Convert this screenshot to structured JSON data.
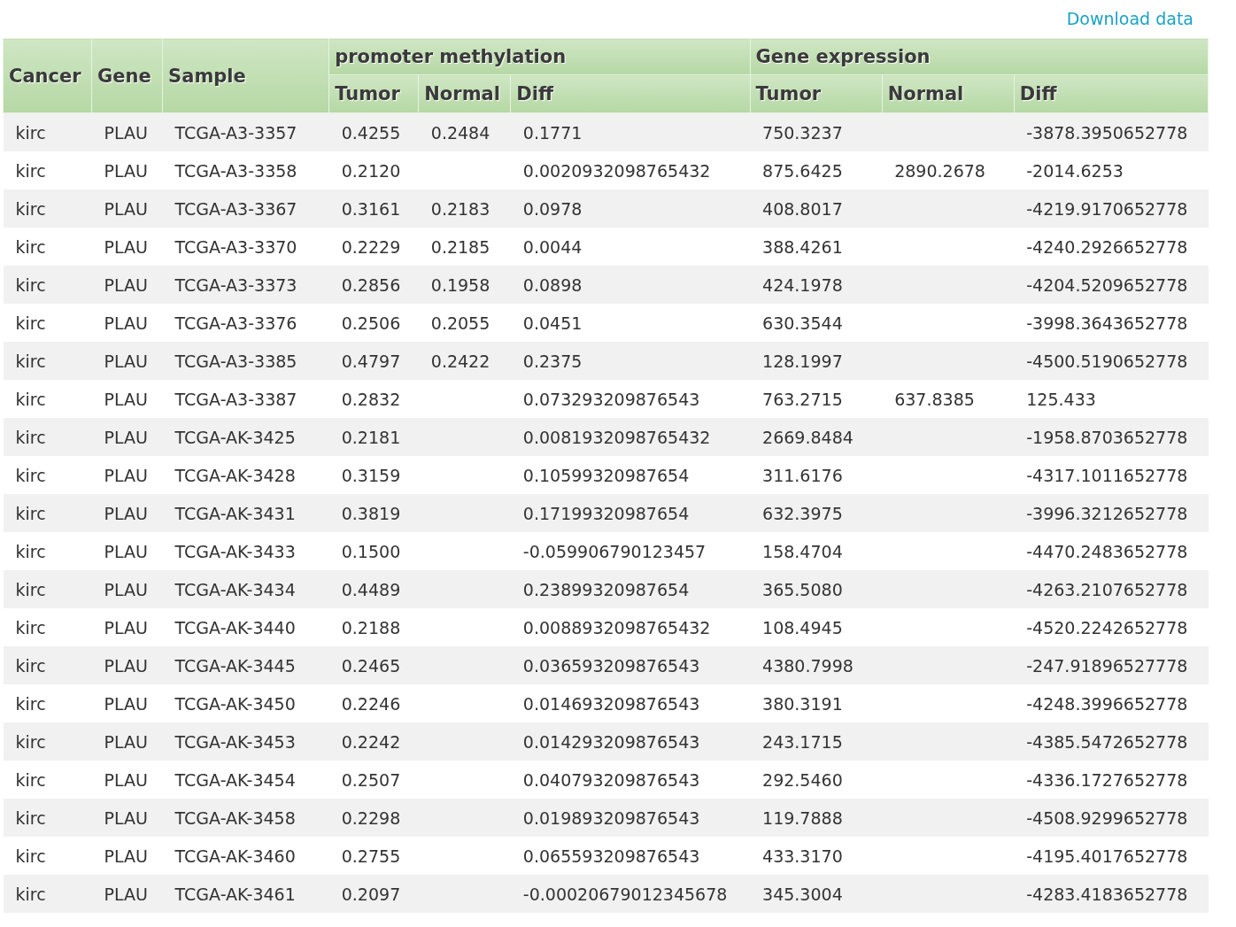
{
  "download_link": "Download data",
  "table": {
    "columns": [
      "Cancer",
      "Gene",
      "Sample"
    ],
    "groups": [
      {
        "title": "promoter methylation",
        "columns": [
          "Tumor",
          "Normal",
          "Diff"
        ]
      },
      {
        "title": "Gene expression",
        "columns": [
          "Tumor",
          "Normal",
          "Diff"
        ]
      }
    ],
    "rows": [
      {
        "cancer": "kirc",
        "gene": "PLAU",
        "sample": "TCGA-A3-3357",
        "meth_tumor": "0.4255",
        "meth_normal": "0.2484",
        "meth_diff": "0.1771",
        "expr_tumor": "750.3237",
        "expr_diff": "-3878.3950652778"
      },
      {
        "cancer": "kirc",
        "gene": "PLAU",
        "sample": "TCGA-A3-3358",
        "meth_tumor": "0.2120",
        "meth_diff": "0.0020932098765432",
        "expr_tumor": "875.6425",
        "expr_normal": "2890.2678",
        "expr_diff": "-2014.6253"
      },
      {
        "cancer": "kirc",
        "gene": "PLAU",
        "sample": "TCGA-A3-3367",
        "meth_tumor": "0.3161",
        "meth_normal": "0.2183",
        "meth_diff": "0.0978",
        "expr_tumor": "408.8017",
        "expr_diff": "-4219.9170652778"
      },
      {
        "cancer": "kirc",
        "gene": "PLAU",
        "sample": "TCGA-A3-3370",
        "meth_tumor": "0.2229",
        "meth_normal": "0.2185",
        "meth_diff": "0.0044",
        "expr_tumor": "388.4261",
        "expr_diff": "-4240.2926652778"
      },
      {
        "cancer": "kirc",
        "gene": "PLAU",
        "sample": "TCGA-A3-3373",
        "meth_tumor": "0.2856",
        "meth_normal": "0.1958",
        "meth_diff": "0.0898",
        "expr_tumor": "424.1978",
        "expr_diff": "-4204.5209652778"
      },
      {
        "cancer": "kirc",
        "gene": "PLAU",
        "sample": "TCGA-A3-3376",
        "meth_tumor": "0.2506",
        "meth_normal": "0.2055",
        "meth_diff": "0.0451",
        "expr_tumor": "630.3544",
        "expr_diff": "-3998.3643652778"
      },
      {
        "cancer": "kirc",
        "gene": "PLAU",
        "sample": "TCGA-A3-3385",
        "meth_tumor": "0.4797",
        "meth_normal": "0.2422",
        "meth_diff": "0.2375",
        "expr_tumor": "128.1997",
        "expr_diff": "-4500.5190652778"
      },
      {
        "cancer": "kirc",
        "gene": "PLAU",
        "sample": "TCGA-A3-3387",
        "meth_tumor": "0.2832",
        "meth_diff": "0.073293209876543",
        "expr_tumor": "763.2715",
        "expr_normal": "637.8385",
        "expr_diff": "125.433"
      },
      {
        "cancer": "kirc",
        "gene": "PLAU",
        "sample": "TCGA-AK-3425",
        "meth_tumor": "0.2181",
        "meth_diff": "0.0081932098765432",
        "expr_tumor": "2669.8484",
        "expr_diff": "-1958.8703652778"
      },
      {
        "cancer": "kirc",
        "gene": "PLAU",
        "sample": "TCGA-AK-3428",
        "meth_tumor": "0.3159",
        "meth_diff": "0.10599320987654",
        "expr_tumor": "311.6176",
        "expr_diff": "-4317.1011652778"
      },
      {
        "cancer": "kirc",
        "gene": "PLAU",
        "sample": "TCGA-AK-3431",
        "meth_tumor": "0.3819",
        "meth_diff": "0.17199320987654",
        "expr_tumor": "632.3975",
        "expr_diff": "-3996.3212652778"
      },
      {
        "cancer": "kirc",
        "gene": "PLAU",
        "sample": "TCGA-AK-3433",
        "meth_tumor": "0.1500",
        "meth_diff": "-0.059906790123457",
        "expr_tumor": "158.4704",
        "expr_diff": "-4470.2483652778"
      },
      {
        "cancer": "kirc",
        "gene": "PLAU",
        "sample": "TCGA-AK-3434",
        "meth_tumor": "0.4489",
        "meth_diff": "0.23899320987654",
        "expr_tumor": "365.5080",
        "expr_diff": "-4263.2107652778"
      },
      {
        "cancer": "kirc",
        "gene": "PLAU",
        "sample": "TCGA-AK-3440",
        "meth_tumor": "0.2188",
        "meth_diff": "0.0088932098765432",
        "expr_tumor": "108.4945",
        "expr_diff": "-4520.2242652778"
      },
      {
        "cancer": "kirc",
        "gene": "PLAU",
        "sample": "TCGA-AK-3445",
        "meth_tumor": "0.2465",
        "meth_diff": "0.036593209876543",
        "expr_tumor": "4380.7998",
        "expr_diff": "-247.91896527778"
      },
      {
        "cancer": "kirc",
        "gene": "PLAU",
        "sample": "TCGA-AK-3450",
        "meth_tumor": "0.2246",
        "meth_diff": "0.014693209876543",
        "expr_tumor": "380.3191",
        "expr_diff": "-4248.3996652778"
      },
      {
        "cancer": "kirc",
        "gene": "PLAU",
        "sample": "TCGA-AK-3453",
        "meth_tumor": "0.2242",
        "meth_diff": "0.014293209876543",
        "expr_tumor": "243.1715",
        "expr_diff": "-4385.5472652778"
      },
      {
        "cancer": "kirc",
        "gene": "PLAU",
        "sample": "TCGA-AK-3454",
        "meth_tumor": "0.2507",
        "meth_diff": "0.040793209876543",
        "expr_tumor": "292.5460",
        "expr_diff": "-4336.1727652778"
      },
      {
        "cancer": "kirc",
        "gene": "PLAU",
        "sample": "TCGA-AK-3458",
        "meth_tumor": "0.2298",
        "meth_diff": "0.019893209876543",
        "expr_tumor": "119.7888",
        "expr_diff": "-4508.9299652778"
      },
      {
        "cancer": "kirc",
        "gene": "PLAU",
        "sample": "TCGA-AK-3460",
        "meth_tumor": "0.2755",
        "meth_diff": "0.065593209876543",
        "expr_tumor": "433.3170",
        "expr_diff": "-4195.4017652778"
      },
      {
        "cancer": "kirc",
        "gene": "PLAU",
        "sample": "TCGA-AK-3461",
        "meth_tumor": "0.2097",
        "meth_diff": "-0.00020679012345678",
        "expr_tumor": "345.3004",
        "expr_diff": "-4283.4183652778"
      }
    ]
  }
}
